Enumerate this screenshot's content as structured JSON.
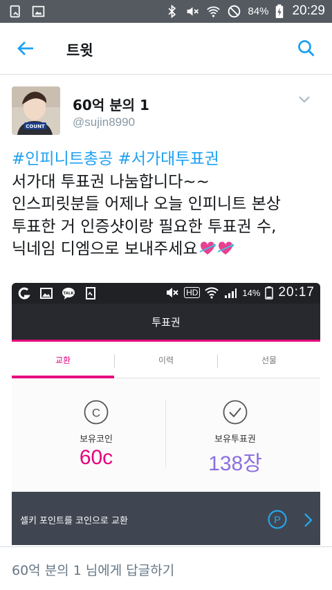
{
  "status_bar": {
    "battery": "84%",
    "time": "20:29",
    "icons": [
      "clipboard-icon",
      "image-icon",
      "bluetooth-icon",
      "mute-icon",
      "wifi-icon",
      "do-not-disturb-icon",
      "battery-charging-icon"
    ]
  },
  "app_bar": {
    "title": "트윗",
    "icons": [
      "back-arrow-icon",
      "search-icon"
    ]
  },
  "tweet": {
    "display_name": "60억 분의 1",
    "handle": "@sujin8990",
    "hashtags": "#인피니트총공 #서가대투표권",
    "lines": [
      "서가대 투표권 나눔합니다~~",
      "인스피릿분들 어제나 오늘 인피니트 본상",
      "투표한 거 인증샷이랑 필요한 투표권 수,",
      "닉네임 디엠으로 보내주세요"
    ],
    "avatar_badge_text": "COUNT"
  },
  "photo": {
    "status": {
      "hd_label": "HD",
      "battery": "14%",
      "time": "20:17"
    },
    "header_title": "투표권",
    "tabs": [
      "교환",
      "이력",
      "선물"
    ],
    "active_tab": "교환",
    "coin": {
      "label": "보유코인",
      "value": "60c",
      "icon_letter": "C"
    },
    "ticket": {
      "label": "보유투표권",
      "value": "138장"
    },
    "footer_text": "셀키 포인트를 코인으로 교환",
    "footer_badge": "P",
    "colors": {
      "accent": "#e6007e",
      "ticket": "#8c6fe0",
      "footer_icon": "#27a5e6"
    }
  },
  "reply": {
    "placeholder": "60억 분의 1 님에게 답글하기"
  },
  "colors": {
    "link_blue": "#1da1f2",
    "status_bar": "#545a60",
    "muted_gray": "#8899a6"
  }
}
